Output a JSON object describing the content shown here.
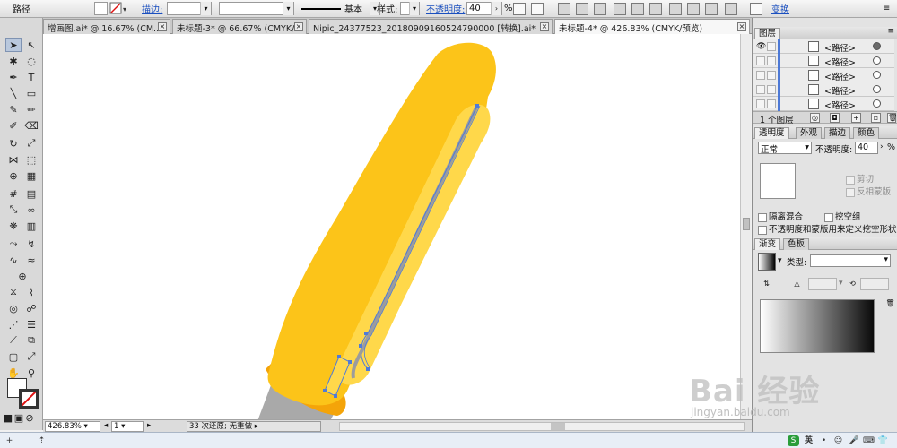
{
  "control_bar": {
    "object_type": "路径",
    "stroke_label": "描边:",
    "profile_value": "基本",
    "style_label": "样式:",
    "opacity_label": "不透明度:",
    "opacity_value": "40",
    "opacity_unit": "%",
    "transform_label": "变换"
  },
  "tabs": [
    {
      "label": "增画图.ai* @ 16.67% (CM...",
      "active": false
    },
    {
      "label": "未标题-3* @ 66.67% (CMYK/...",
      "active": false
    },
    {
      "label": "Nipic_24377523_20180909160524790000 [转换].ai*",
      "active": false
    },
    {
      "label": "未标题-4* @ 426.83% (CMYK/预览)",
      "active": true
    }
  ],
  "status": {
    "zoom": "426.83%",
    "artboard": "1",
    "history": "33 次还原; 无重做"
  },
  "layers_panel": {
    "title": "图层",
    "rows": [
      {
        "name": "<路径>",
        "target": "filled"
      },
      {
        "name": "<路径>",
        "target": "empty"
      },
      {
        "name": "<路径>",
        "target": "empty"
      },
      {
        "name": "<路径>",
        "target": "empty"
      },
      {
        "name": "<路径>",
        "target": "empty"
      }
    ],
    "footer": "1 个图层"
  },
  "transparency_panel": {
    "tabs": [
      "透明度",
      "外观",
      "描边",
      "颜色"
    ],
    "blend_mode": "正常",
    "opacity_label": "不透明度:",
    "opacity_value": "40",
    "opacity_unit": "%",
    "clip_label": "剪切",
    "invert_mask_label": "反相蒙版",
    "isolate_blend_label": "隔离混合",
    "knockout_group_label": "挖空组",
    "opacity_mask_label": "不透明度和蒙版用来定义挖空形状"
  },
  "gradient_panel": {
    "tabs": [
      "渐变",
      "色板"
    ],
    "type_label": "类型:",
    "type_value": ""
  },
  "taskbar": {
    "ime_label": "英"
  },
  "watermark": {
    "brand": "Bai 经验",
    "url": "jingyan.baidu.com"
  },
  "colors": {
    "pen_body": "#fcc419",
    "pen_shadow": "#f4a409",
    "pen_highlight": "#ffd84a",
    "pen_tip": "#a9a9a9",
    "selection": "#4f7bd8"
  }
}
